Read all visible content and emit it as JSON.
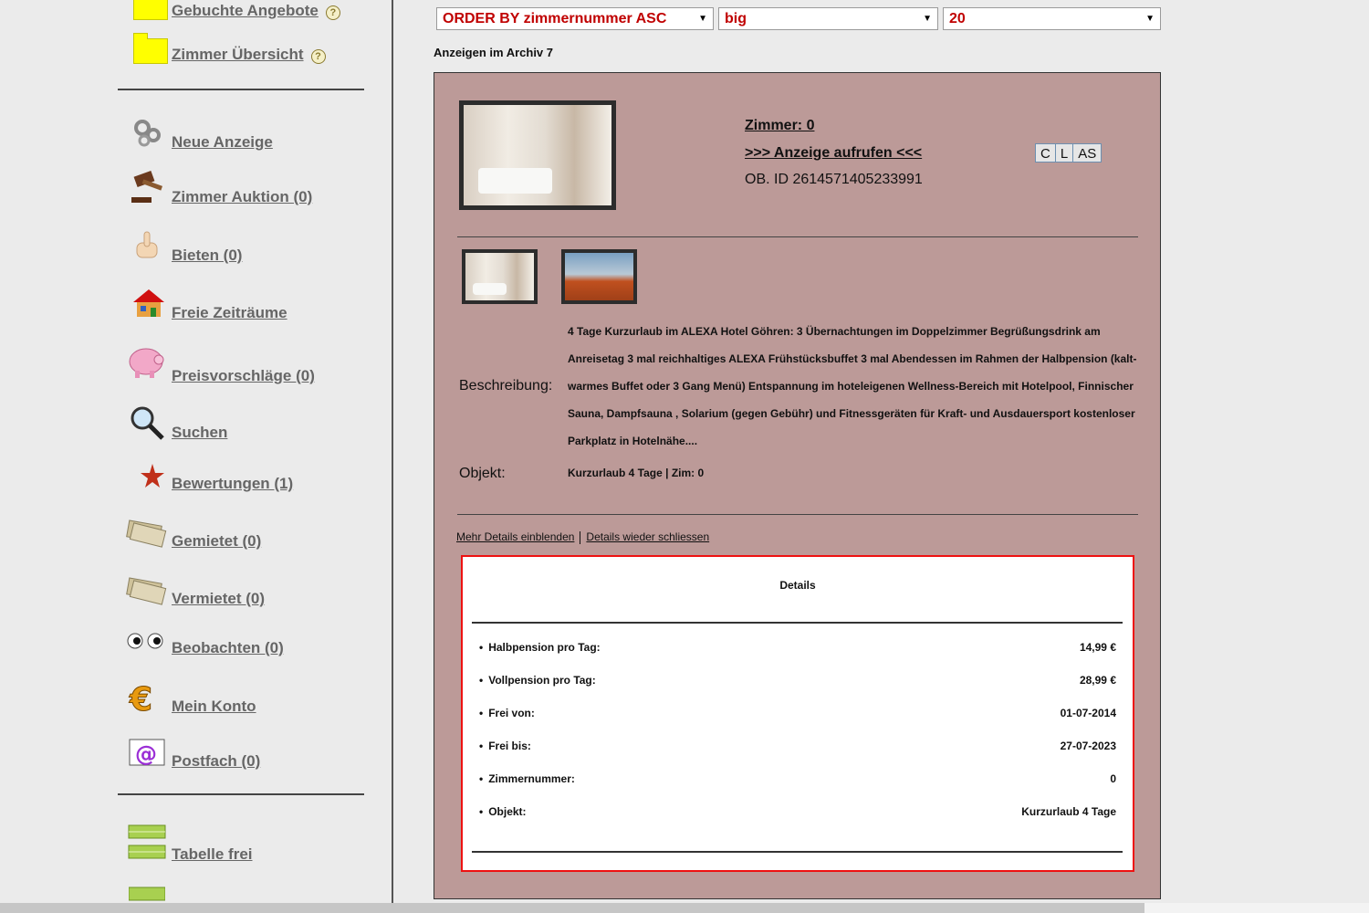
{
  "sidebar": {
    "top": [
      {
        "label": "Gebuchte Angebote",
        "help": "?"
      },
      {
        "label": "Zimmer Übersicht",
        "help": "?"
      }
    ],
    "nav": [
      {
        "label": "Neue Anzeige",
        "icon": "gears-icon"
      },
      {
        "label": "Zimmer Auktion (0)",
        "icon": "gavel-icon"
      },
      {
        "label": "Bieten (0)",
        "icon": "hand-icon"
      },
      {
        "label": "Freie Zeiträume",
        "icon": "house-icon"
      },
      {
        "label": "Preisvorschläge (0)",
        "icon": "piggy-bank-icon"
      },
      {
        "label": "Suchen",
        "icon": "magnifier-icon"
      },
      {
        "label": "Bewertungen (1)",
        "icon": "star-icon"
      },
      {
        "label": "Gemietet (0)",
        "icon": "money-icon"
      },
      {
        "label": "Vermietet (0)",
        "icon": "money-icon"
      },
      {
        "label": "Beobachten (0)",
        "icon": "eyes-icon"
      },
      {
        "label": "Mein Konto",
        "icon": "euro-icon"
      },
      {
        "label": "Postfach (0)",
        "icon": "at-mail-icon"
      }
    ],
    "bottom": [
      {
        "label": "Tabelle frei",
        "icon": "table-icon"
      }
    ]
  },
  "filters": {
    "order": "ORDER BY zimmernummer ASC",
    "size": "big",
    "count": "20"
  },
  "archive_label": "Anzeigen im Archiv 7",
  "listing": {
    "room_link": "Zimmer: 0",
    "open_link": ">>> Anzeige aufrufen <<<",
    "object_id": "OB. ID 2614571405233991",
    "buttons": [
      "C",
      "L",
      "AS"
    ],
    "description_label": "Beschreibung:",
    "description": "4 Tage Kurzurlaub im ALEXA Hotel Göhren: 3 Übernachtungen im Doppelzimmer Begrüßungsdrink am Anreisetag 3 mal reichhaltiges ALEXA Frühstücksbuffet 3 mal Abendessen im Rahmen der Halbpension (kalt-warmes Buffet oder 3 Gang Menü) Entspannung im hoteleigenen Wellness-Bereich mit Hotelpool, Finnischer Sauna, Dampfsauna , Solarium (gegen Gebühr) und Fitnessgeräten für Kraft- und Ausdauersport kostenloser Parkplatz in Hotelnähe....",
    "object_label": "Objekt:",
    "object_value": "Kurzurlaub 4 Tage | Zim: 0",
    "more_details": "Mehr Details einblenden",
    "close_details": "Details wieder schliessen"
  },
  "details": {
    "title": "Details",
    "rows": [
      {
        "key": "Halbpension pro Tag:",
        "value": "14,99 €"
      },
      {
        "key": "Vollpension pro Tag:",
        "value": "28,99 €"
      },
      {
        "key": "Frei von:",
        "value": "01-07-2014"
      },
      {
        "key": "Frei bis:",
        "value": "27-07-2023"
      },
      {
        "key": "Zimmernummer:",
        "value": "0"
      },
      {
        "key": "Objekt:",
        "value": "Kurzurlaub 4 Tage"
      }
    ]
  }
}
